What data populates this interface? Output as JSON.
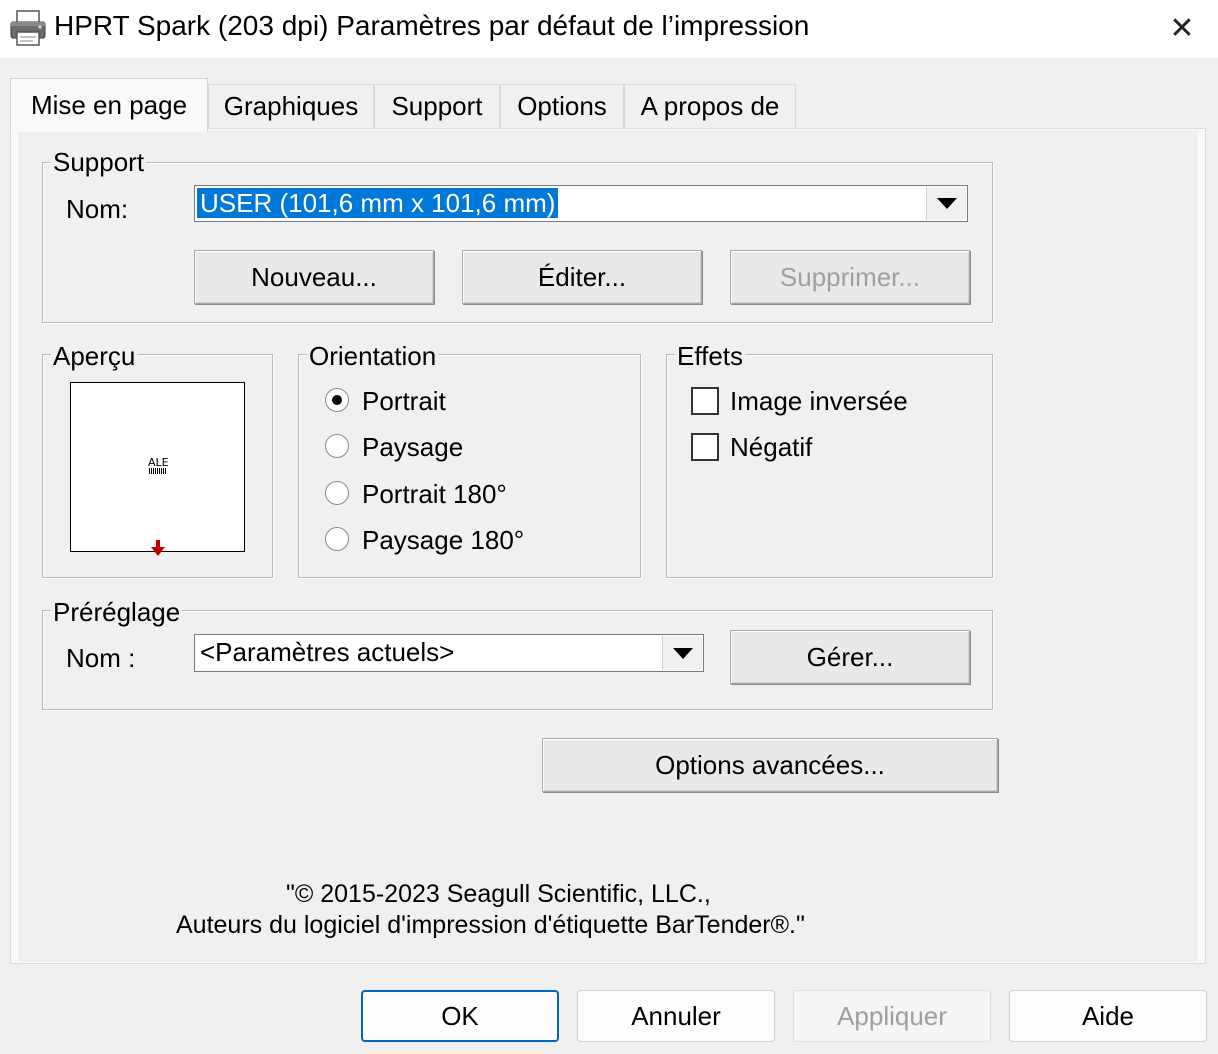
{
  "window": {
    "title": "HPRT Spark (203 dpi) Paramètres par défaut de l’impression",
    "close_glyph": "✕"
  },
  "tabs": [
    {
      "label": "Mise en page",
      "active": true
    },
    {
      "label": "Graphiques",
      "active": false
    },
    {
      "label": "Support",
      "active": false
    },
    {
      "label": "Options",
      "active": false
    },
    {
      "label": "A propos de",
      "active": false
    }
  ],
  "support_group": {
    "legend": "Support",
    "name_label": "Nom:",
    "name_value": "USER (101,6 mm x 101,6 mm)",
    "buttons": {
      "new": "Nouveau...",
      "edit": "Éditer...",
      "delete": "Supprimer...",
      "delete_enabled": false
    }
  },
  "preview_group": {
    "legend": "Aperçu",
    "label_text": "ALE",
    "feed_arrow_color": "#c00000"
  },
  "orientation_group": {
    "legend": "Orientation",
    "options": [
      {
        "label": "Portrait",
        "selected": true
      },
      {
        "label": "Paysage",
        "selected": false
      },
      {
        "label": "Portrait 180°",
        "selected": false
      },
      {
        "label": "Paysage 180°",
        "selected": false
      }
    ]
  },
  "effects_group": {
    "legend": "Effets",
    "options": [
      {
        "label": "Image inversée",
        "checked": false
      },
      {
        "label": "Négatif",
        "checked": false
      }
    ]
  },
  "preset_group": {
    "legend": "Préréglage",
    "name_label": "Nom :",
    "name_value": "<Paramètres actuels>",
    "manage_button": "Gérer..."
  },
  "advanced_button": "Options avancées...",
  "copyright": {
    "line1": "\"© 2015-2023 Seagull Scientific, LLC.,",
    "line2": "Auteurs du logiciel d'impression d'étiquette BarTender®.\""
  },
  "dialog_buttons": {
    "ok": "OK",
    "cancel": "Annuler",
    "apply": "Appliquer",
    "apply_enabled": false,
    "help": "Aide"
  },
  "colors": {
    "selection": "#0078d7",
    "default_button_border": "#0067c0"
  }
}
